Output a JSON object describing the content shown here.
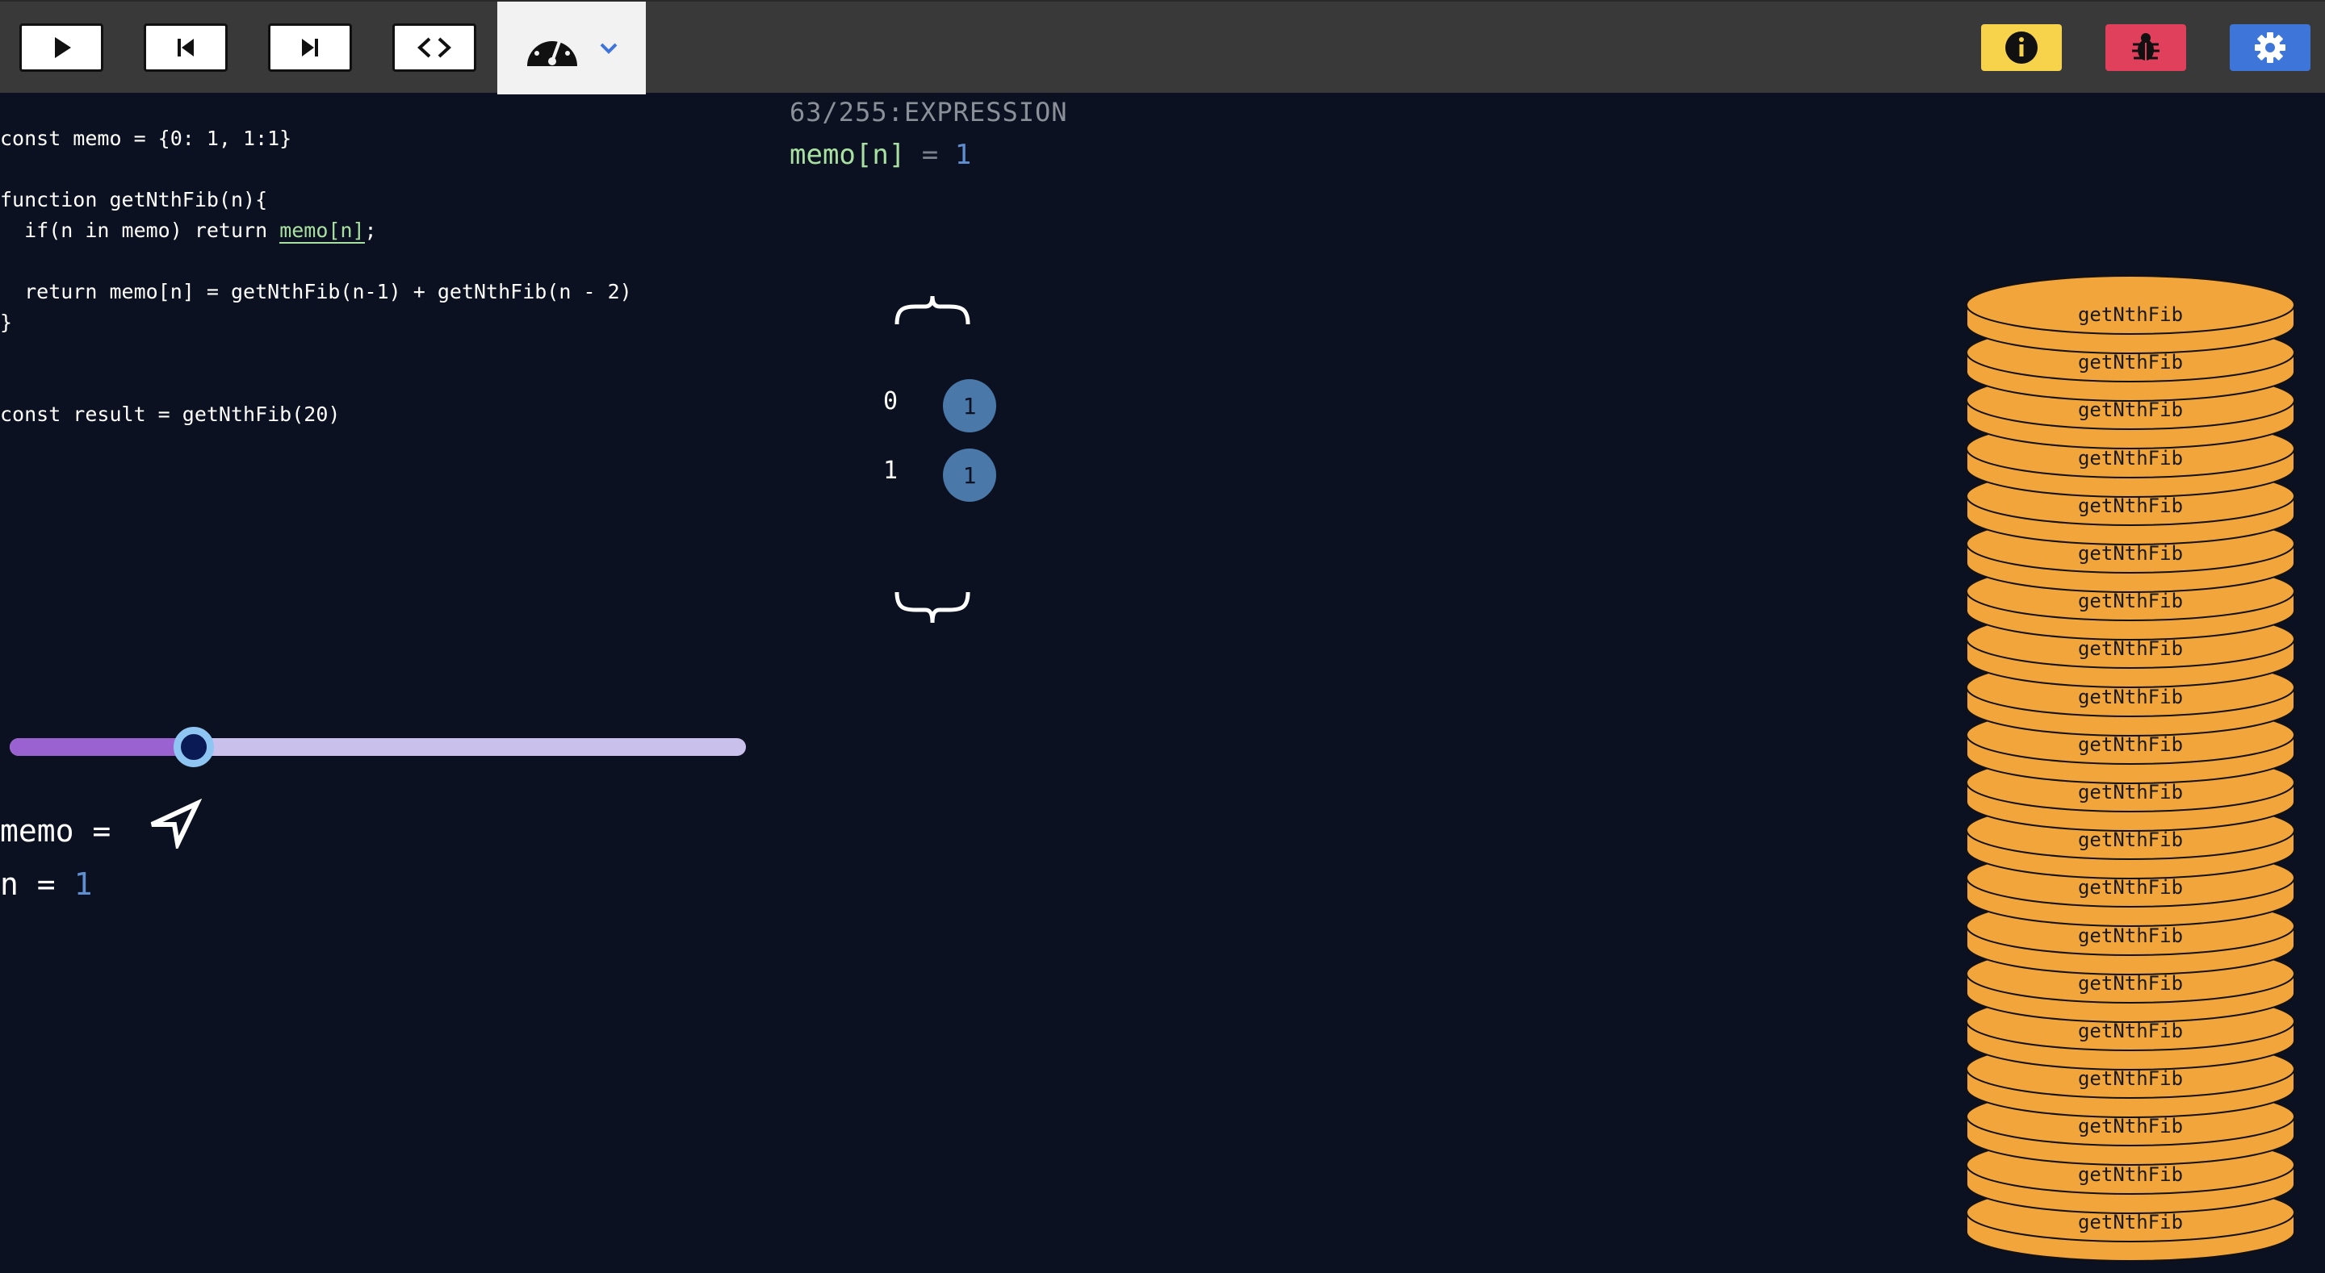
{
  "toolbar": {
    "buttons": [
      "play",
      "step-back",
      "step-forward",
      "code-toggle"
    ],
    "speed_icon": "speedometer-icon",
    "dropdown_icon": "chevron-down-icon",
    "info_color": "#f7d34c",
    "bug_color": "#e0405b",
    "settings_color": "#3e75d9"
  },
  "code": {
    "lines": [
      "const memo = {0: 1, 1:1}",
      "",
      "function getNthFib(n){",
      "  if(n in memo) return memo[n];",
      "",
      "  return memo[n] = getNthFib(n-1) + getNthFib(n - 2)",
      "}",
      "",
      "",
      "const result = getNthFib(20)"
    ],
    "highlight": "memo[n]"
  },
  "slider": {
    "fraction": 0.25
  },
  "variables": {
    "memo_label": "memo",
    "memo_eq": "=",
    "n_label": "n",
    "n_eq": "=",
    "n_value": "1"
  },
  "execution": {
    "step": "63/255:EXPRESSION",
    "expr_lhs": "memo[n]",
    "expr_op": "=",
    "expr_value": "1"
  },
  "memo_object": {
    "entries": [
      {
        "key": "0",
        "value": "1"
      },
      {
        "key": "1",
        "value": "1"
      }
    ]
  },
  "call_stack": {
    "frames": [
      "getNthFib",
      "getNthFib",
      "getNthFib",
      "getNthFib",
      "getNthFib",
      "getNthFib",
      "getNthFib",
      "getNthFib",
      "getNthFib",
      "getNthFib",
      "getNthFib",
      "getNthFib",
      "getNthFib",
      "getNthFib",
      "getNthFib",
      "getNthFib",
      "getNthFib",
      "getNthFib",
      "getNthFib",
      "getNthFib"
    ],
    "color": "#f2a53a"
  }
}
